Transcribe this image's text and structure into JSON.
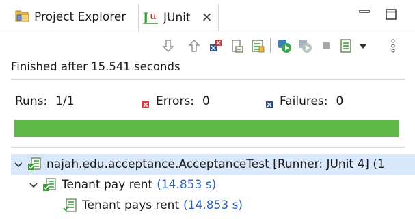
{
  "tabs": {
    "project_explorer": "Project Explorer",
    "junit": "JUnit",
    "close_glyph": "✕"
  },
  "status_text": "Finished after 15.541 seconds",
  "counters": {
    "runs_label": "Runs:",
    "runs_value": "1/1",
    "errors_label": "Errors:",
    "errors_value": "0",
    "failures_label": "Failures:",
    "failures_value": "0"
  },
  "progress": {
    "fraction": 1.0,
    "color": "#5fb848"
  },
  "tree": {
    "suite_label": "najah.edu.acceptance.AcceptanceTest [Runner: JUnit 4] (1",
    "feature_label": "Tenant pay rent",
    "feature_time": "(14.853 s)",
    "scenario_label": "Tenant pays rent",
    "scenario_time": "(14.853 s)"
  },
  "colors": {
    "accent_green": "#5fb848",
    "selection": "#d9e8fb",
    "time_blue": "#2a5fc4",
    "error_red": "#d9383a",
    "failure_blue": "#2c4f8c"
  },
  "icons": [
    "project-explorer-icon",
    "junit-icon",
    "minimize-icon",
    "maximize-icon",
    "next-failure-icon",
    "previous-failure-icon",
    "show-failures-only-icon",
    "scroll-lock-icon",
    "show-skipped-icon",
    "rerun-icon",
    "rerun-failed-first-icon",
    "stop-icon",
    "test-run-history-icon",
    "view-menu-icon",
    "more-icon"
  ]
}
